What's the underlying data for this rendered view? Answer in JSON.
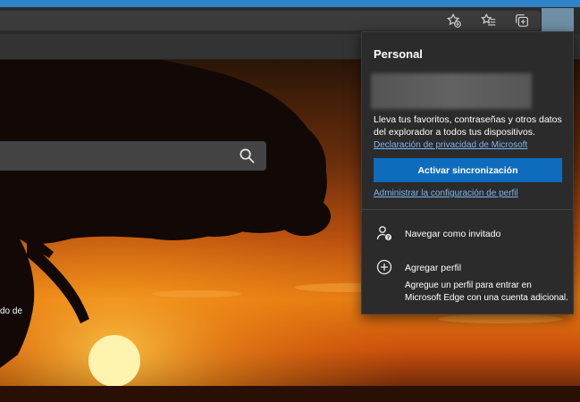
{
  "toolbar": {
    "icons": [
      "add-favorite-icon",
      "favorites-icon",
      "collections-icon"
    ]
  },
  "search": {
    "icon": "search-icon"
  },
  "page": {
    "snippet_text": "do de"
  },
  "profile_panel": {
    "title": "Personal",
    "sync_description": "Lleva tus favoritos, contraseñas y otros datos del explorador a todos tus dispositivos.",
    "privacy_link": "Declaración de privacidad de Microsoft",
    "sync_button": "Activar sincronización",
    "manage_profile_link": "Administrar la configuración de perfil",
    "menu": {
      "guest": {
        "label": "Navegar como invitado",
        "icon": "guest-icon"
      },
      "add_profile": {
        "label": "Agregar perfil",
        "icon": "add-circle-icon",
        "description": "Agregue un perfil para entrar en Microsoft Edge con una cuenta adicional."
      }
    }
  },
  "colors": {
    "accent": "#0f6cbd",
    "link": "#7ab5f0",
    "panel_bg": "#2b2b2b",
    "sky_top": "#3b1b0a",
    "sky_mid": "#e07a0e",
    "sun": "#fff2a8"
  }
}
